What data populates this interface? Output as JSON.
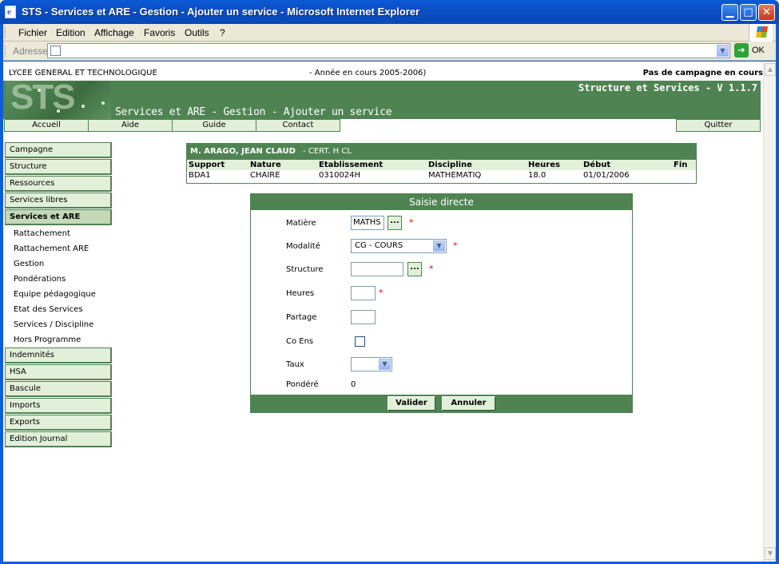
{
  "window": {
    "title": "STS - Services et ARE - Gestion - Ajouter un service - Microsoft Internet Explorer"
  },
  "menubar": {
    "items": [
      "Fichier",
      "Edition",
      "Affichage",
      "Favoris",
      "Outils",
      "?"
    ]
  },
  "addressbar": {
    "label": "Adresse",
    "value": "",
    "go_label": "OK"
  },
  "topinfo": {
    "school": "LYCEE GENERAL ET TECHNOLOGIQUE",
    "year": "- Année en cours 2005-2006)",
    "campaign": "Pas de campagne en cours"
  },
  "banner": {
    "logo": "STS",
    "version": "Structure et Services - V 1.1.7",
    "page_title": "Services et ARE - Gestion - Ajouter un service"
  },
  "nav": {
    "items": [
      "Accueil",
      "Aide",
      "Guide",
      "Contact"
    ],
    "quit": "Quitter"
  },
  "sidebar": {
    "sections_top": [
      "Campagne",
      "Structure",
      "Ressources",
      "Services libres"
    ],
    "active": "Services et ARE",
    "sub_items": [
      "Rattachement",
      "Rattachement ARE",
      "Gestion",
      "Pondérations",
      "Equipe pédagogique",
      "Etat des Services",
      "Services / Discipline",
      "Hors Programme"
    ],
    "sections_bottom": [
      "Indemnités",
      "HSA",
      "Bascule",
      "Imports",
      "Exports",
      "Edition Journal"
    ]
  },
  "agent": {
    "name": "M. ARAGO, JEAN CLAUD",
    "grade": "- CERT. H CL",
    "columns": [
      "Support",
      "Nature",
      "Etablissement",
      "Discipline",
      "Heures",
      "Début",
      "Fin"
    ],
    "row": [
      "BDA1",
      "CHAIRE",
      "0310024H",
      "MATHEMATIQ",
      "18.0",
      "01/01/2006",
      ""
    ]
  },
  "form": {
    "title": "Saisie directe",
    "matiere_label": "Matière",
    "matiere_value": "MATHS",
    "modalite_label": "Modalité",
    "modalite_value": "CG - COURS",
    "structure_label": "Structure",
    "structure_value": "",
    "heures_label": "Heures",
    "heures_value": "",
    "partage_label": "Partage",
    "partage_value": "",
    "coens_label": "Co Ens",
    "taux_label": "Taux",
    "taux_value": "",
    "pondere_label": "Pondéré",
    "pondere_value": "0",
    "lookup_label": "...",
    "required_mark": "*",
    "submit_label": "Valider",
    "cancel_label": "Annuler"
  },
  "colors": {
    "brand_green": "#4f8452",
    "light_green": "#e2efd9",
    "required": "#ee0000"
  }
}
